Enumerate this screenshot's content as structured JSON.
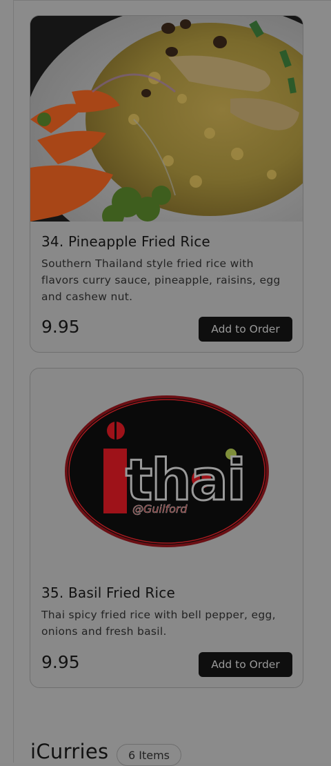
{
  "menu_items": [
    {
      "title": "34. Pineapple Fried Rice",
      "description": "Southern Thailand style fried rice with flavors curry sauce, pineapple, raisins, egg and cashew nut.",
      "price": "9.95",
      "button_label": "Add to Order",
      "image": "pineapple-fried-rice-photo"
    },
    {
      "title": "35. Basil Fried Rice",
      "description": "Thai spicy fried rice with bell pepper, egg, onions and fresh basil.",
      "price": "9.95",
      "button_label": "Add to Order",
      "image": "restaurant-logo"
    }
  ],
  "logo": {
    "wordmark": "thai",
    "tagline": "@Guilford"
  },
  "next_section": {
    "title": "iCurries",
    "count_label": "6 Items"
  },
  "colors": {
    "overlay_bg": "#8b8b8b",
    "button_bg": "#0e0e0e",
    "logo_red": "#b5121b",
    "logo_black": "#0a0a0a"
  }
}
